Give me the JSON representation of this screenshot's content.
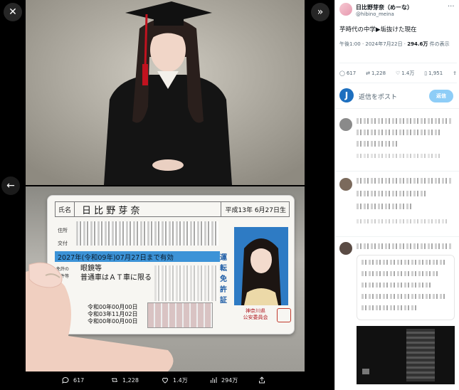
{
  "viewer": {
    "stats": {
      "replies": "617",
      "reposts": "1,228",
      "likes": "1.4万",
      "views": "294万"
    }
  },
  "license": {
    "name_label": "氏名",
    "name": "日 比 野 芽 奈",
    "birth": "平成13年 6月27日生",
    "address_label": "住所",
    "issued_label": "交付",
    "expiry": "2027年(令和09年)07月27日まで有効",
    "cond_label_1": "免許の",
    "cond_label_2": "条件等",
    "conditions": "眼鏡等\n普通車はＡＴ車に限る",
    "side_text": "運転免許証",
    "dates": [
      "令和00年00月00日",
      "令和03年11月02日",
      "令和00年00月00日"
    ],
    "issuer": "神奈川県\n公安委員会"
  },
  "tweet": {
    "display_name": "日比野芽奈（めーな）",
    "handle": "@hibino_meina",
    "text": "芋時代の中学▶垢抜けた現在",
    "time": "午後1:00 · 2024年7月22日 · ",
    "views_count": "294.6万",
    "views_suffix": " 件の表示",
    "stats": {
      "replies": "617",
      "reposts": "1,228",
      "likes": "1.4万",
      "bookmarks": "1,951"
    },
    "reply_avatar_letter": "J",
    "reply_placeholder": "返信をポスト",
    "reply_button": "返信"
  },
  "colors": {
    "accent": "#1d9bf0",
    "panel_bg": "#ffffff",
    "viewer_bg": "#000000"
  }
}
